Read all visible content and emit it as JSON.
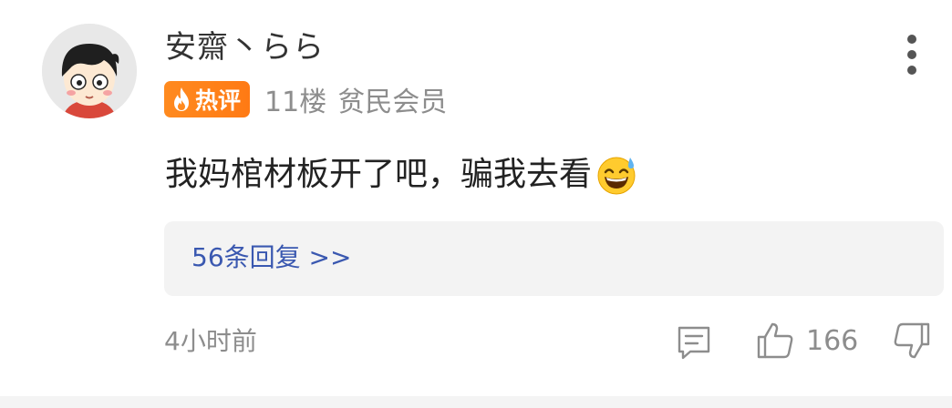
{
  "comment": {
    "username": "安齋丶らら",
    "badge": {
      "label": "热评",
      "icon": "flame-icon",
      "color": "#ff8a1f"
    },
    "floor": "11楼",
    "member_level": "贫民会员",
    "text": "我妈棺材板开了吧，骗我去看",
    "emoji": "grinning-sweat-emoji",
    "replies_label": "56条回复 >>",
    "timestamp": "4小时前",
    "like_count": "166",
    "link_color": "#3a58b0"
  }
}
